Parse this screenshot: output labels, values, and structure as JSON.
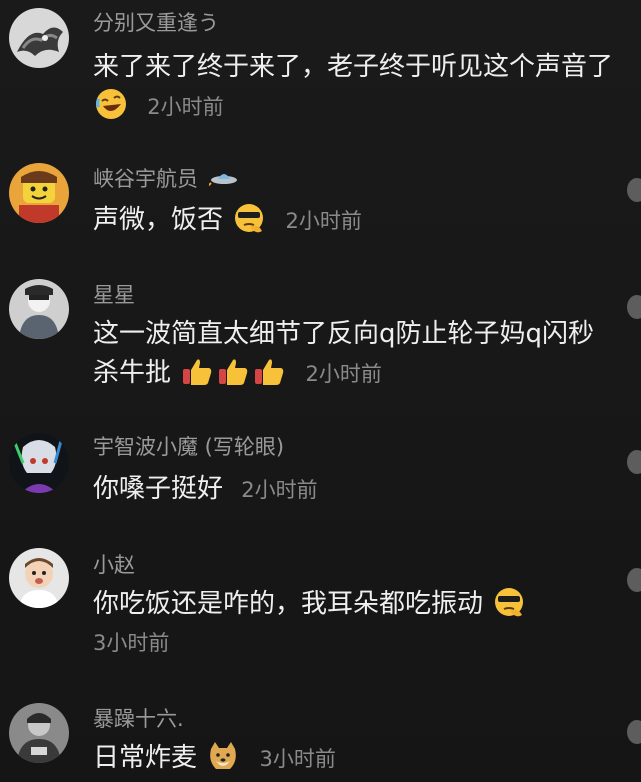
{
  "comments": [
    {
      "username": "分别又重逢う",
      "text": "来了来了终于来了，老子终于听见这个声音了",
      "emoji": "rofl-emoji",
      "time": "2小时前"
    },
    {
      "username": "峡谷宇航员",
      "badge": "ufo-icon",
      "text": "声微，饭否",
      "emoji": "cool-thinking-emoji",
      "time": "2小时前"
    },
    {
      "username": "星星",
      "text": "这一波简直太细节了反向q防止轮子妈q闪秒杀牛批",
      "emoji": "thumbs-up-emoji",
      "emoji_count": 3,
      "time": "2小时前"
    },
    {
      "username": "宇智波小魔 (写轮眼)",
      "text": "你嗓子挺好",
      "time": "2小时前"
    },
    {
      "username": "小赵",
      "text": "你吃饭还是咋的，我耳朵都吃振动",
      "emoji": "cool-thinking-emoji",
      "time": "3小时前"
    },
    {
      "username": "暴躁十六.",
      "text": "日常炸麦",
      "emoji": "doge-emoji",
      "time": "3小时前"
    }
  ],
  "colors": {
    "background": "#161616",
    "username": "#9a9a9a",
    "text": "#efefef",
    "time": "#8a8a8a"
  }
}
